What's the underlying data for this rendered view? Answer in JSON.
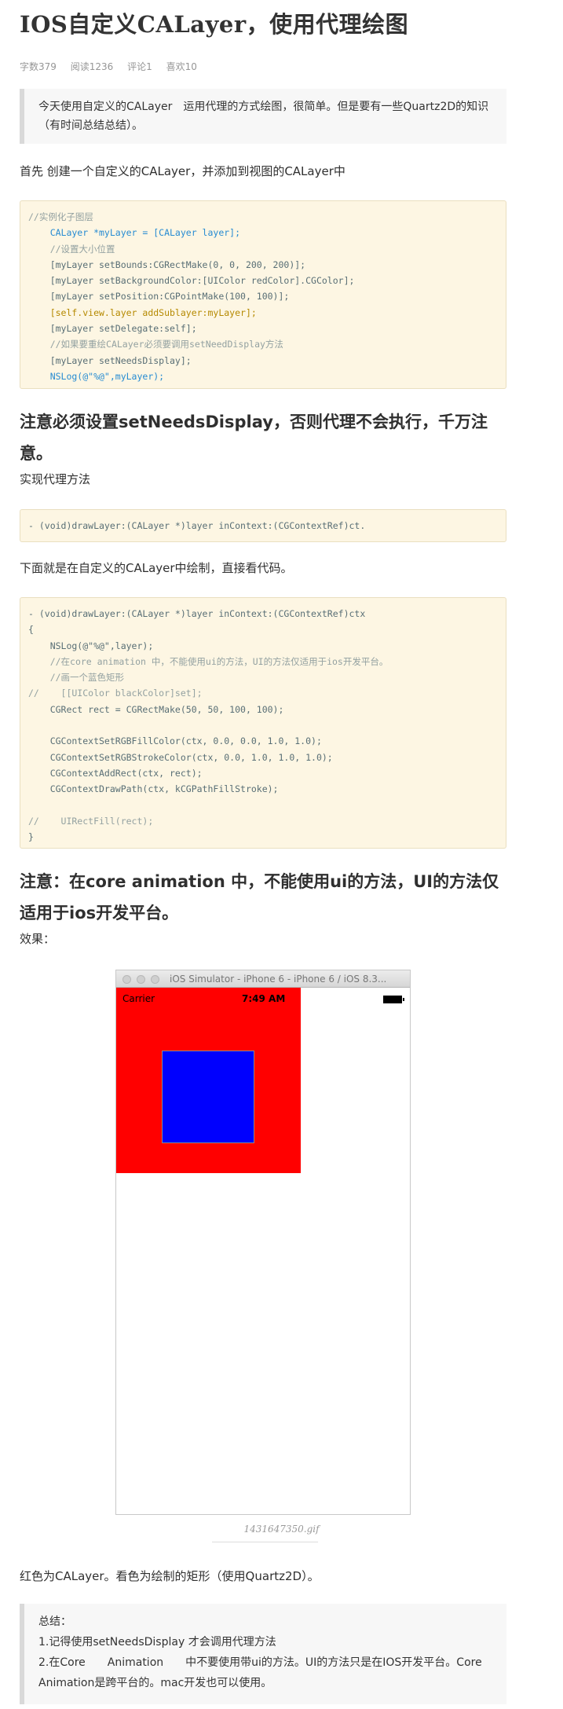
{
  "title": "IOS自定义CALayer，使用代理绘图",
  "meta": {
    "words": "字数379",
    "reads": "阅读1236",
    "comments": "评论1",
    "likes": "喜欢10"
  },
  "intro_quote": "今天使用自定义的CALayer　运用代理的方式绘图，很简单。但是要有一些Quartz2D的知识（有时间总结总结）。",
  "para1": "首先 创建一个自定义的CALayer，并添加到视图的CALayer中",
  "code1": [
    "//实例化子图层",
    "    CALayer *myLayer = [CALayer layer];",
    "    //设置大小位置",
    "    [myLayer setBounds:CGRectMake(0, 0, 200, 200)];",
    "    [myLayer setBackgroundColor:[UIColor redColor].CGColor];",
    "    [myLayer setPosition:CGPointMake(100, 100)];",
    "    [self.view.layer addSublayer:myLayer];",
    "    [myLayer setDelegate:self];",
    "    //如果要重绘CALayer必须要调用setNeedDisplay方法",
    "    [myLayer setNeedsDisplay];",
    "    NSLog(@\"%@\",myLayer);"
  ],
  "heading1": "注意必须设置setNeedsDisplay，否则代理不会执行，千万注意。",
  "para2": "实现代理方法",
  "code2": "- (void)drawLayer:(CALayer *)layer inContext:(CGContextRef)ct.",
  "para3": "下面就是在自定义的CALayer中绘制，直接看代码。",
  "code3": [
    "- (void)drawLayer:(CALayer *)layer inContext:(CGContextRef)ctx",
    "{",
    "    NSLog(@\"%@\",layer);",
    "    //在core animation 中，不能使用ui的方法，UI的方法仅适用于ios开发平台。",
    "    //画一个蓝色矩形",
    "//    [[UIColor blackColor]set];",
    "    CGRect rect = CGRectMake(50, 50, 100, 100);",
    "",
    "    CGContextSetRGBFillColor(ctx, 0.0, 0.0, 1.0, 1.0);",
    "    CGContextSetRGBStrokeColor(ctx, 0.0, 1.0, 1.0, 1.0);",
    "    CGContextAddRect(ctx, rect);",
    "    CGContextDrawPath(ctx, kCGPathFillStroke);",
    "",
    "//    UIRectFill(rect);",
    "}"
  ],
  "heading2": "注意：在core animation 中，不能使用ui的方法，UI的方法仅适用于ios开发平台。",
  "para4": "效果：",
  "simulator": {
    "window_title": "iOS Simulator - iPhone 6 - iPhone 6 / iOS 8.3...",
    "carrier": "Carrier",
    "time": "7:49 AM",
    "layer_color": "#ff0000",
    "rect_color": "#0000fe"
  },
  "caption": "1431647350.gif",
  "para5": "红色为CALayer。看色为绘制的矩形（使用Quartz2D）。",
  "summary": {
    "title": "总结：",
    "line1": "1.记得使用setNeedsDisplay 才会调用代理方法",
    "line2": "2.在Core　　Animation　　中不要使用带ui的方法。UI的方法只是在IOS开发平台。Core",
    "line3": "Animation是跨平台的。mac开发也可以使用。"
  }
}
